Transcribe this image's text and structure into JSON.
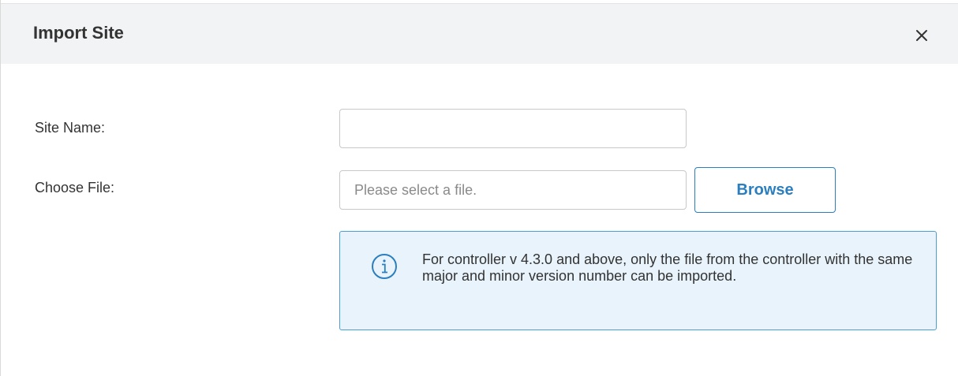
{
  "dialog": {
    "title": "Import Site",
    "close_icon": "close-icon"
  },
  "form": {
    "site_name_label": "Site Name:",
    "site_name_value": "",
    "choose_file_label": "Choose File:",
    "file_placeholder": "Please select a file.",
    "browse_label": "Browse"
  },
  "notice": {
    "icon": "info-icon",
    "text": "For controller v 4.3.0 and above, only the file from the controller with the same major and minor version number can be imported."
  },
  "colors": {
    "accent": "#2b7fbf",
    "notice_bg": "#e8f3fb",
    "header_bg": "#f2f3f5"
  }
}
